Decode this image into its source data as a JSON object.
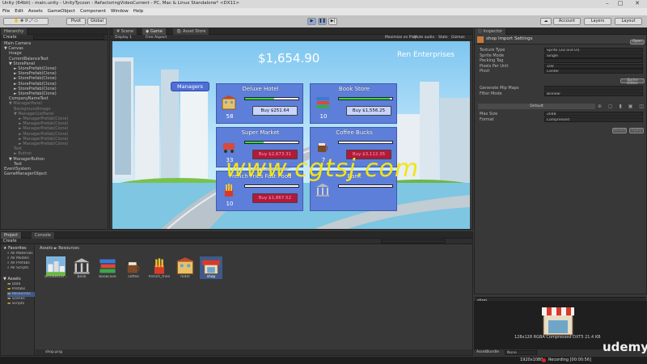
{
  "window": {
    "title": "Unity (64bit) - main.unity - UnityTycoon - RefactoringVideoCurrent - PC, Mac & Linux Standalone* <DX11>"
  },
  "menu": [
    "File",
    "Edit",
    "Assets",
    "GameObject",
    "Component",
    "Window",
    "Help"
  ],
  "toolbar": {
    "pivot": "Pivot",
    "global": "Global",
    "account": "Account",
    "layers": "Layers",
    "layout": "Layout"
  },
  "hierarchy": {
    "tab": "Hierarchy",
    "create": "Create",
    "items": [
      {
        "label": "Main Camera",
        "indent": 0,
        "dim": false
      },
      {
        "label": "▼ Canvas",
        "indent": 0,
        "dim": false
      },
      {
        "label": "Image",
        "indent": 1,
        "dim": false
      },
      {
        "label": "CurrentBalanceText",
        "indent": 1,
        "dim": false
      },
      {
        "label": "▼ StorePanel",
        "indent": 1,
        "dim": false
      },
      {
        "label": "► StorePrefab(Clone)",
        "indent": 2,
        "dim": false
      },
      {
        "label": "► StorePrefab(Clone)",
        "indent": 2,
        "dim": false
      },
      {
        "label": "► StorePrefab(Clone)",
        "indent": 2,
        "dim": false
      },
      {
        "label": "► StorePrefab(Clone)",
        "indent": 2,
        "dim": false
      },
      {
        "label": "► StorePrefab(Clone)",
        "indent": 2,
        "dim": false
      },
      {
        "label": "► StorePrefab(Clone)",
        "indent": 2,
        "dim": false
      },
      {
        "label": "CompanyNameText",
        "indent": 1,
        "dim": false
      },
      {
        "label": "▼ ManagerPanel",
        "indent": 1,
        "dim": true
      },
      {
        "label": "BackgroundImage",
        "indent": 2,
        "dim": true
      },
      {
        "label": "▼ ManagerListPanel",
        "indent": 2,
        "dim": true
      },
      {
        "label": "► ManagerPrefab(Clone)",
        "indent": 3,
        "dim": true
      },
      {
        "label": "► ManagerPrefab(Clone)",
        "indent": 3,
        "dim": true
      },
      {
        "label": "► ManagerPrefab(Clone)",
        "indent": 3,
        "dim": true
      },
      {
        "label": "► ManagerPrefab(Clone)",
        "indent": 3,
        "dim": true
      },
      {
        "label": "► ManagerPrefab(Clone)",
        "indent": 3,
        "dim": true
      },
      {
        "label": "► ManagerPrefab(Clone)",
        "indent": 3,
        "dim": true
      },
      {
        "label": "Text",
        "indent": 2,
        "dim": true
      },
      {
        "label": "► Button",
        "indent": 2,
        "dim": true
      },
      {
        "label": "▼ ManagerButton",
        "indent": 1,
        "dim": false
      },
      {
        "label": "Text",
        "indent": 2,
        "dim": false
      },
      {
        "label": "EventSystem",
        "indent": 0,
        "dim": false
      },
      {
        "label": "GameManagerObject",
        "indent": 0,
        "dim": false
      }
    ]
  },
  "scene": {
    "tabs": [
      "Scene",
      "Game",
      "Asset Store"
    ],
    "display": "Display 1",
    "aspect": "Free Aspect",
    "options": [
      "Maximize on Play",
      "Mute audio",
      "Stats",
      "Gizmos"
    ]
  },
  "game": {
    "balance": "$1,654.90",
    "company": "Ren Enterprises",
    "managers_button": "Managers",
    "stores": [
      {
        "name": "Deluxe Hotel",
        "count": "58",
        "buy": "Buy $251.64",
        "icon": "hotel-icon",
        "progress": 0.55,
        "btn_color": "#c8d4ff",
        "btn_text": "#111111"
      },
      {
        "name": "Book Store",
        "count": "10",
        "buy": "Buy $1,556.25",
        "icon": "books-icon",
        "progress": 0.95,
        "btn_color": "#c8d4ff",
        "btn_text": "#111111"
      },
      {
        "name": "Super Market",
        "count": "33",
        "buy": "Buy $2,673.31",
        "icon": "cart-icon",
        "progress": 0.35,
        "btn_color": "#b4183a",
        "btn_text": "#f2a0b0"
      },
      {
        "name": "Coffee Bucks",
        "count": "7",
        "buy": "Buy $3,112.35",
        "icon": "coffee-icon",
        "progress": 0.0,
        "btn_color": "#b4183a",
        "btn_text": "#f2a0b0"
      },
      {
        "name": "French Fries Fast Food",
        "count": "10",
        "buy": "Buy $1,867.52",
        "icon": "fries-icon",
        "progress": 0.0,
        "btn_color": "#b4183a",
        "btn_text": "#f2a0b0"
      },
      {
        "name": "Bank",
        "count": "",
        "buy": "",
        "icon": "bank-icon",
        "progress": 0.0,
        "btn_color": "#b4183a",
        "btn_text": "#f2a0b0"
      }
    ]
  },
  "watermark": "www.cgtsj.com",
  "inspector": {
    "tab": "Inspector",
    "title": "shop Import Settings",
    "open": "Open",
    "rows": [
      {
        "label": "Texture Type",
        "value": "Sprite (2D and UI)"
      },
      {
        "label": "Sprite Mode",
        "value": "Single"
      },
      {
        "label": "Packing Tag",
        "value": ""
      },
      {
        "label": "Pixels Per Unit",
        "value": "100"
      },
      {
        "label": "Pivot",
        "value": "Center"
      }
    ],
    "sprite_editor": "Sprite Editor",
    "rows2": [
      {
        "label": "Generate Mip Maps",
        "value": ""
      },
      {
        "label": "Filter Mode",
        "value": "Bilinear"
      }
    ],
    "default_label": "Default",
    "rows3": [
      {
        "label": "Max Size",
        "value": "2048"
      },
      {
        "label": "Format",
        "value": "Compressed"
      }
    ],
    "revert": "Revert",
    "apply": "Apply",
    "preview_title": "shop",
    "preview_info": "128x128 RGBA Compressed DXT5 21.4 KB",
    "assetbundle": "AssetBundle",
    "none": "None"
  },
  "project": {
    "tabs": [
      "Project",
      "Console"
    ],
    "create": "Create",
    "favorites": "Favorites",
    "fav_items": [
      "All Materials",
      "All Models",
      "All Prefabs",
      "All Scripts"
    ],
    "assets": "Assets",
    "asset_folders": [
      "Data",
      "Prefabs",
      "Resources",
      "Scenes",
      "Scripts"
    ],
    "breadcrumb": "Assets ► Resources",
    "files": [
      {
        "name": "architector...",
        "icon": "architecture-icon"
      },
      {
        "name": "bank",
        "icon": "bank-icon"
      },
      {
        "name": "bookcase",
        "icon": "books-icon"
      },
      {
        "name": "coffee",
        "icon": "coffee-icon"
      },
      {
        "name": "french_fries",
        "icon": "fries-icon"
      },
      {
        "name": "hotel",
        "icon": "hotel-icon"
      },
      {
        "name": "shop",
        "icon": "shop-icon"
      }
    ],
    "footer": "shop.png"
  },
  "statusbar": {
    "resolution": "1920x1080",
    "recording": "Recording [00:00:56]"
  },
  "brand": "udemy"
}
